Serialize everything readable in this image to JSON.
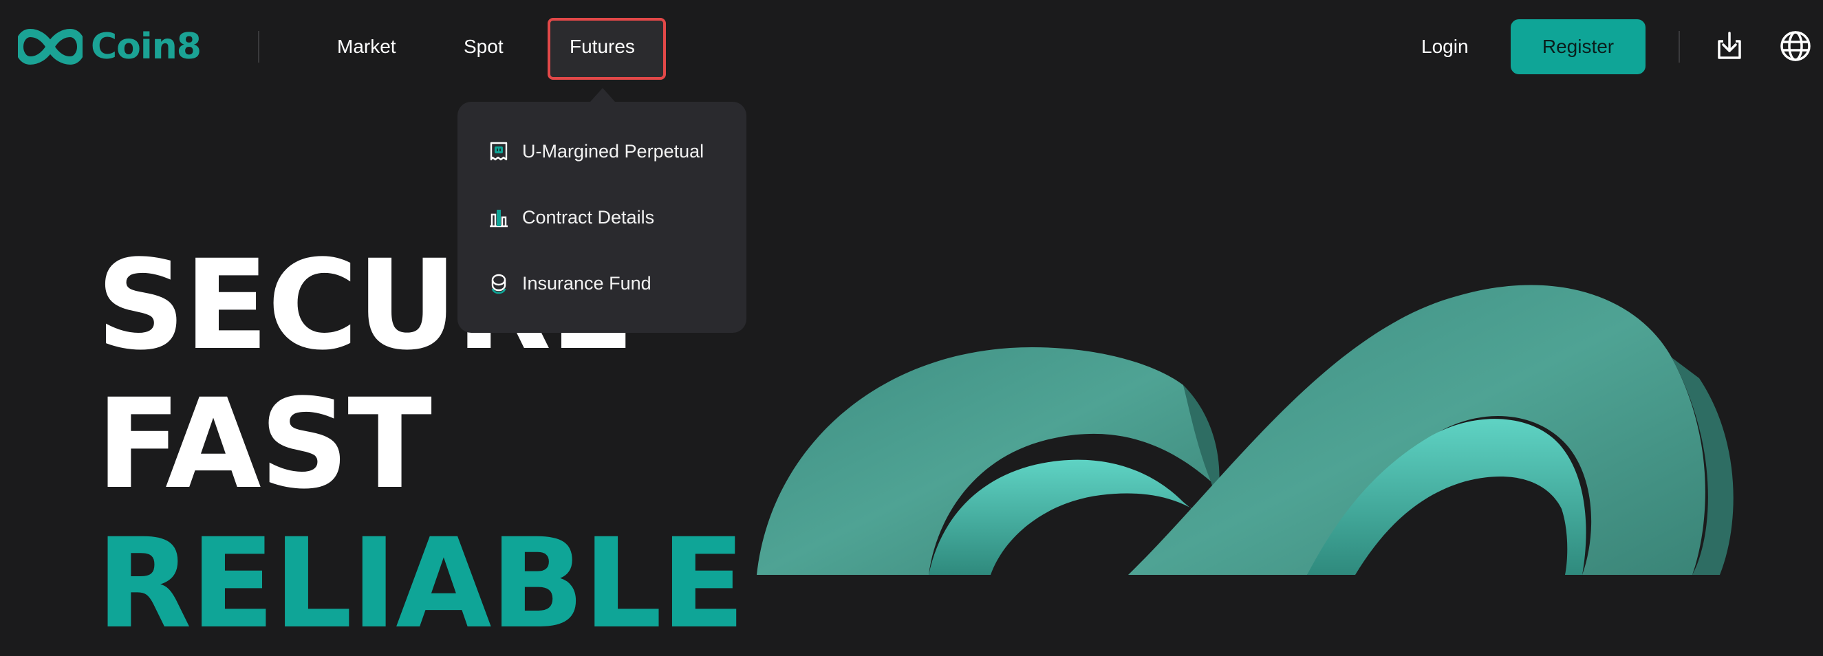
{
  "brand": {
    "name": "Coin8",
    "accent": "#0fa597",
    "highlight": "#e24848"
  },
  "nav": {
    "market": "Market",
    "spot": "Spot",
    "futures": "Futures"
  },
  "header": {
    "login": "Login",
    "register": "Register",
    "download_icon": "download-icon",
    "language_icon": "globe-icon"
  },
  "futures_menu": {
    "items": [
      {
        "label": "U-Margined Perpetual",
        "icon": "ticket-icon"
      },
      {
        "label": "Contract Details",
        "icon": "bar-chart-icon"
      },
      {
        "label": "Insurance Fund",
        "icon": "coin-stack-icon"
      }
    ]
  },
  "hero": {
    "line1": "SECURE",
    "line2": "FAST",
    "line3": "RELIABLE"
  }
}
